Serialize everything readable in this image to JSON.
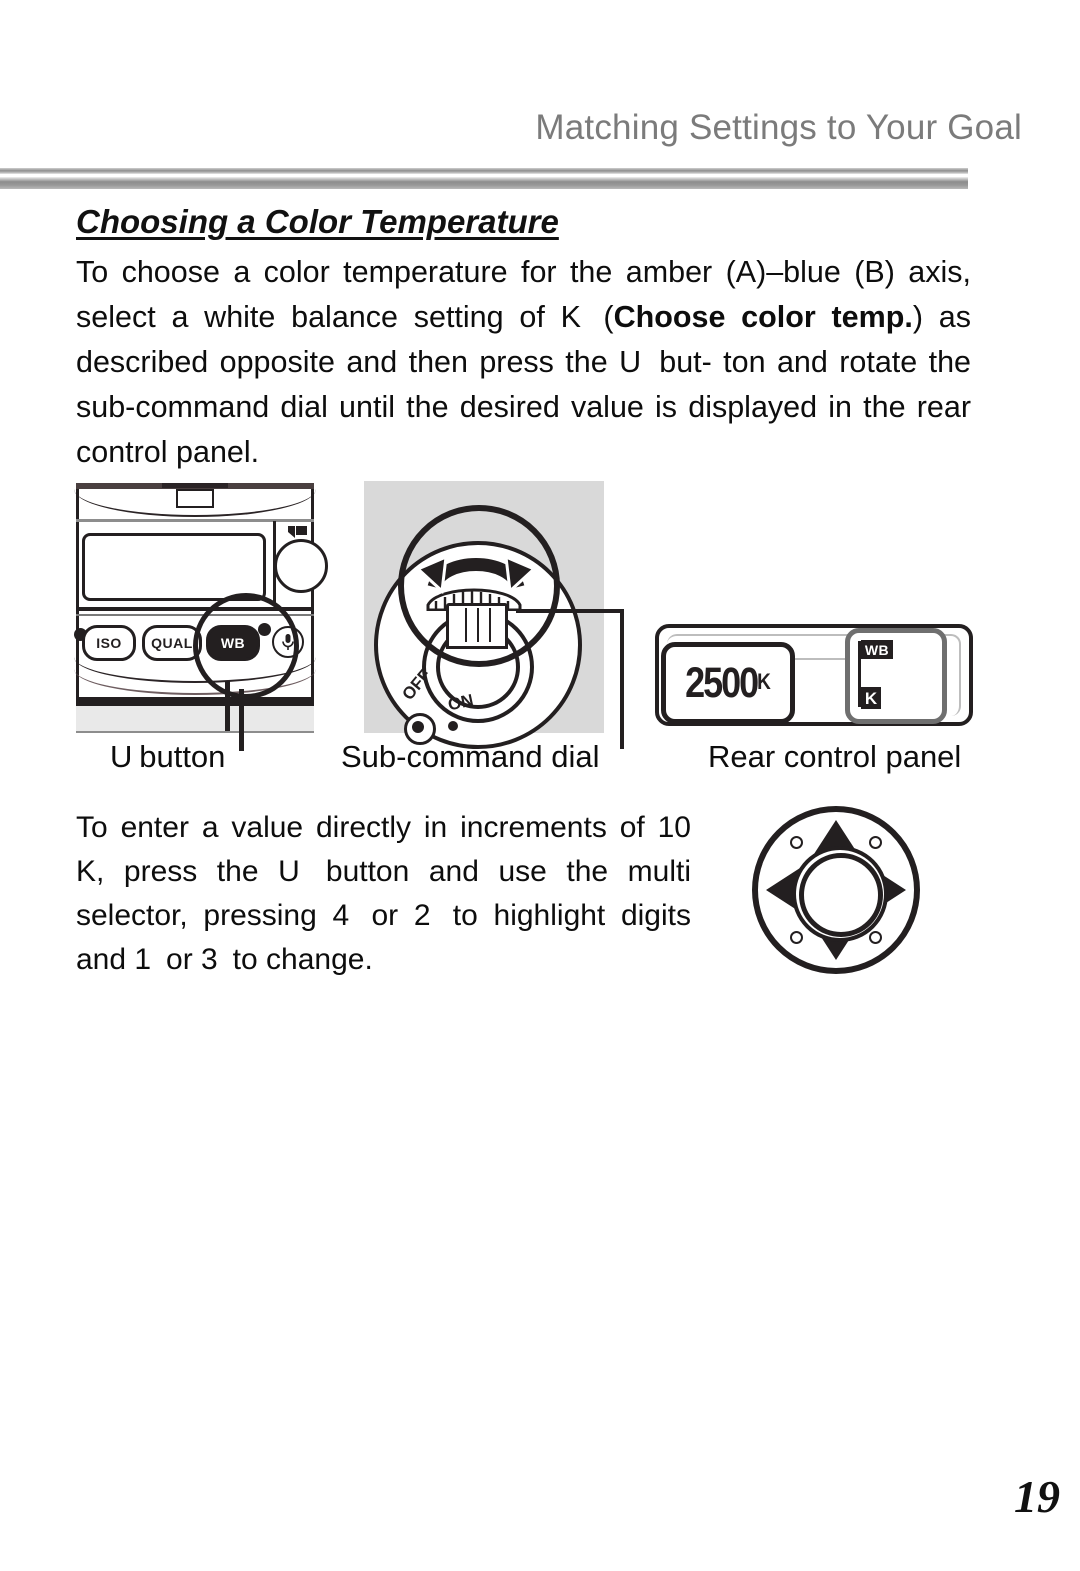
{
  "page": {
    "running_header": "Matching Settings to Your Goal",
    "page_number": "19",
    "accent_rule_color": "#8c8c8c",
    "header_text_color": "#7b7b7b"
  },
  "section": {
    "heading": "Choosing a Color Temperature",
    "paragraph_1": {
      "line_1": "To choose a color temperature for the amber (A)–blue (B)",
      "line_2_a": "axis, select a white balance setting of ",
      "line_2_sym": "K",
      "line_2_b": " (",
      "line_2_bold": "Choose color",
      "line_3_bold": "temp.",
      "line_3_a": ") as described opposite and then press the ",
      "line_3_sym": "U",
      "line_3_b": " but-",
      "line_4": "ton and rotate the sub-command dial until the desired",
      "line_5": "value is displayed in the rear control panel."
    },
    "paragraph_2": {
      "line_1": "To enter a value directly in increments",
      "line_2_a": "of 10 K, press the ",
      "line_2_sym": "U",
      "line_2_b": " button and use",
      "line_3_a": "the multi selector, pressing ",
      "line_3_sym1": "4",
      "line_3_mid": " or ",
      "line_3_sym2": "2",
      "line_3_b": " to",
      "line_4_a": "highlight digits and ",
      "line_4_sym1": "1",
      "line_4_mid": " or ",
      "line_4_sym2": "3",
      "line_4_b": " to change."
    }
  },
  "figures": {
    "camera": {
      "buttons": {
        "iso": "ISO",
        "qual": "QUAL",
        "wb": "WB"
      },
      "mic_icon": "microphone-icon"
    },
    "dial": {
      "power_off_label": "OFF",
      "power_on_label": "ON",
      "rotate_icon": "rotate-arrows-icon"
    },
    "rear_control_panel": {
      "kelvin_value": "2500",
      "kelvin_unit": "K",
      "wb_tag": "WB",
      "k_tag": "K"
    },
    "multi_selector": {
      "up_icon": "arrow-up-icon",
      "down_icon": "arrow-down-icon",
      "left_icon": "arrow-left-icon",
      "right_icon": "arrow-right-icon"
    }
  },
  "captions": {
    "u_button_sym": "U",
    "u_button_text": "button",
    "sub_command_dial": "Sub-command dial",
    "rear_control_panel": "Rear control panel"
  }
}
